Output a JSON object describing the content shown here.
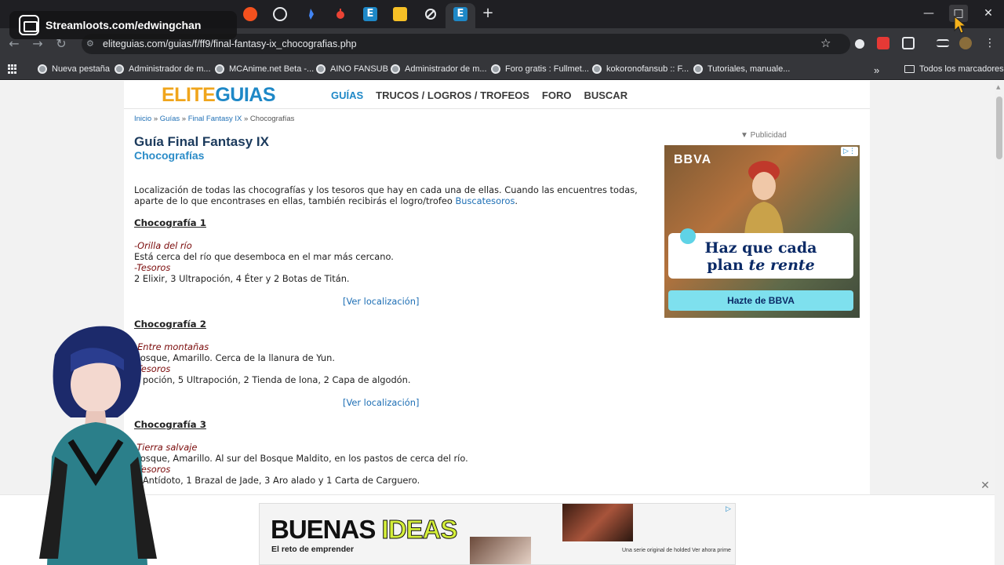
{
  "overlay": {
    "label": "Streamloots.com/edwingchan"
  },
  "browser": {
    "url": "eliteguias.com/guias/f/ff9/final-fantasy-ix_chocografias.php",
    "new_tab_symbol": "+",
    "window": {
      "minimize": "—",
      "maximize": "□",
      "close": "✕"
    },
    "tab_icon_colors": [
      "#f4511e",
      "#e8eaed",
      "#4285f4",
      "#ea4335",
      "#1e88c7",
      "#f6c026",
      "#e8eaed",
      "#1e88c7"
    ]
  },
  "bookmarks": {
    "items": [
      "Nueva pestaña",
      "Administrador de m...",
      "MCAnime.net Beta -...",
      "AINO FANSUB",
      "Administrador de m...",
      "Foro gratis : Fullmet...",
      "kokoronofansub :: F...",
      "Tutoriales, manuale..."
    ],
    "overflow": "»",
    "all_bookmarks": "Todos los marcadores"
  },
  "site": {
    "logo_part1": "ELITE",
    "logo_part2": "GUIAS",
    "nav": [
      "GUÍAS",
      "TRUCOS / LOGROS / TROFEOS",
      "FORO",
      "BUSCAR"
    ],
    "breadcrumb": [
      "Inicio",
      "Guías",
      "Final Fantasy IX",
      "Chocografías"
    ],
    "breadcrumb_sep": "»",
    "title": "Guía Final Fantasy IX",
    "subtitle": "Chocografías",
    "intro_text": "Localización de todas las chocografías y los tesoros que hay en cada una de ellas. Cuando las encuentres todas, aparte de lo que encontrases en ellas, también recibirás el logro/trofeo ",
    "intro_link": "Buscatesoros",
    "intro_end": ".",
    "sections": [
      {
        "title": "Chocografía 1",
        "place_label": "-Orilla del río",
        "place_desc": "Está cerca del río que desemboca en el mar más cercano.",
        "treasure_label": "-Tesoros",
        "treasures": "2 Elixir, 3 Ultrapoción, 4 Éter y 2 Botas de Titán.",
        "link": "[Ver localización]"
      },
      {
        "title": "Chocografía 2",
        "place_label": "-Entre montañas",
        "place_desc": "Bosque, Amarillo. Cerca de la llanura de Yun.",
        "treasure_label": "-Tesoros",
        "treasures": "5 poción, 5 Ultrapoción, 2 Tienda de lona, 2 Capa de algodón.",
        "link": "[Ver localización]"
      },
      {
        "title": "Chocografía 3",
        "place_label": "-Tierra salvaje",
        "place_desc": "Bosque, Amarillo. Al sur del Bosque Maldito, en los pastos de cerca del río.",
        "treasure_label": "-Tesoros",
        "treasures": "5 Antídoto, 1 Brazal de Jade, 3 Aro alado y 1 Carta de Carguero."
      }
    ]
  },
  "ads": {
    "publicidad": "▼ Publicidad",
    "bbva": {
      "brand": "BBVA",
      "headline_1": "Haz que cada",
      "headline_2a": "plan ",
      "headline_2b": "te rente",
      "cta": "Hazte de BBVA"
    },
    "banner": {
      "title_1": "BUENAS ",
      "title_2": "IDEAS",
      "subtitle": "El reto de emprender",
      "footer": "Una serie original de holded  Ver ahora prime"
    },
    "close": "✕"
  }
}
